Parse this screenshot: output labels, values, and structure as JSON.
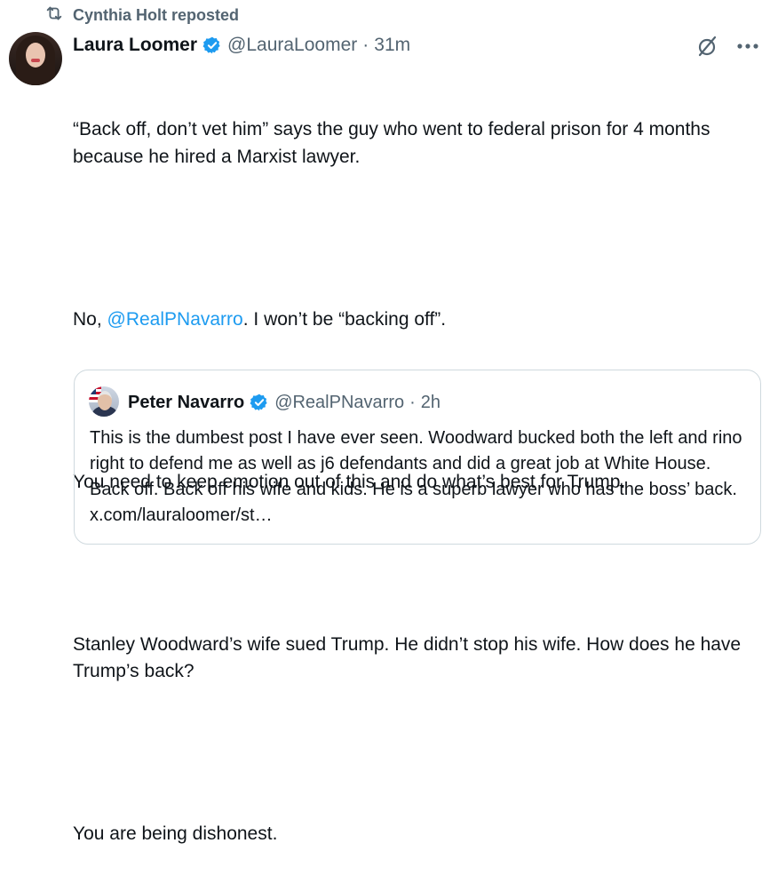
{
  "repost": {
    "label": "Cynthia Holt reposted",
    "icon": "repost-icon"
  },
  "tweet": {
    "author_name": "Laura Loomer",
    "author_handle": "@LauraLoomer",
    "separator": "·",
    "time": "31m",
    "verified_color": "#1d9bf0",
    "paragraphs": [
      "“Back off, don’t vet him” says the guy who went to federal prison for 4 months because he hired a Marxist lawyer.",
      "No, ",
      "You need to keep emotion out of this and do what’s best for Trump.",
      "Stanley Woodward’s wife sued Trump. He didn’t stop his wife. How does he have Trump’s back?",
      "You are being dishonest."
    ],
    "mention": "@RealPNavarro",
    "mention_suffix": ". I won’t be “backing off”.",
    "icons": [
      "grok-icon",
      "more-icon"
    ]
  },
  "quote": {
    "author_name": "Peter Navarro",
    "author_handle": "@RealPNavarro",
    "separator": "·",
    "time": "2h",
    "text": "This is the dumbest post I have ever seen.  Woodward bucked both the left and rino right to defend me as well as j6 defendants and did a great job at White House. Back off.  Back off his wife and kids.  He is a superb lawyer who has the boss’ back. x.com/lauraloomer/st…"
  },
  "colors": {
    "text": "#0f1419",
    "secondary": "#536471",
    "link": "#1d9bf0",
    "border": "#cfd9de"
  }
}
